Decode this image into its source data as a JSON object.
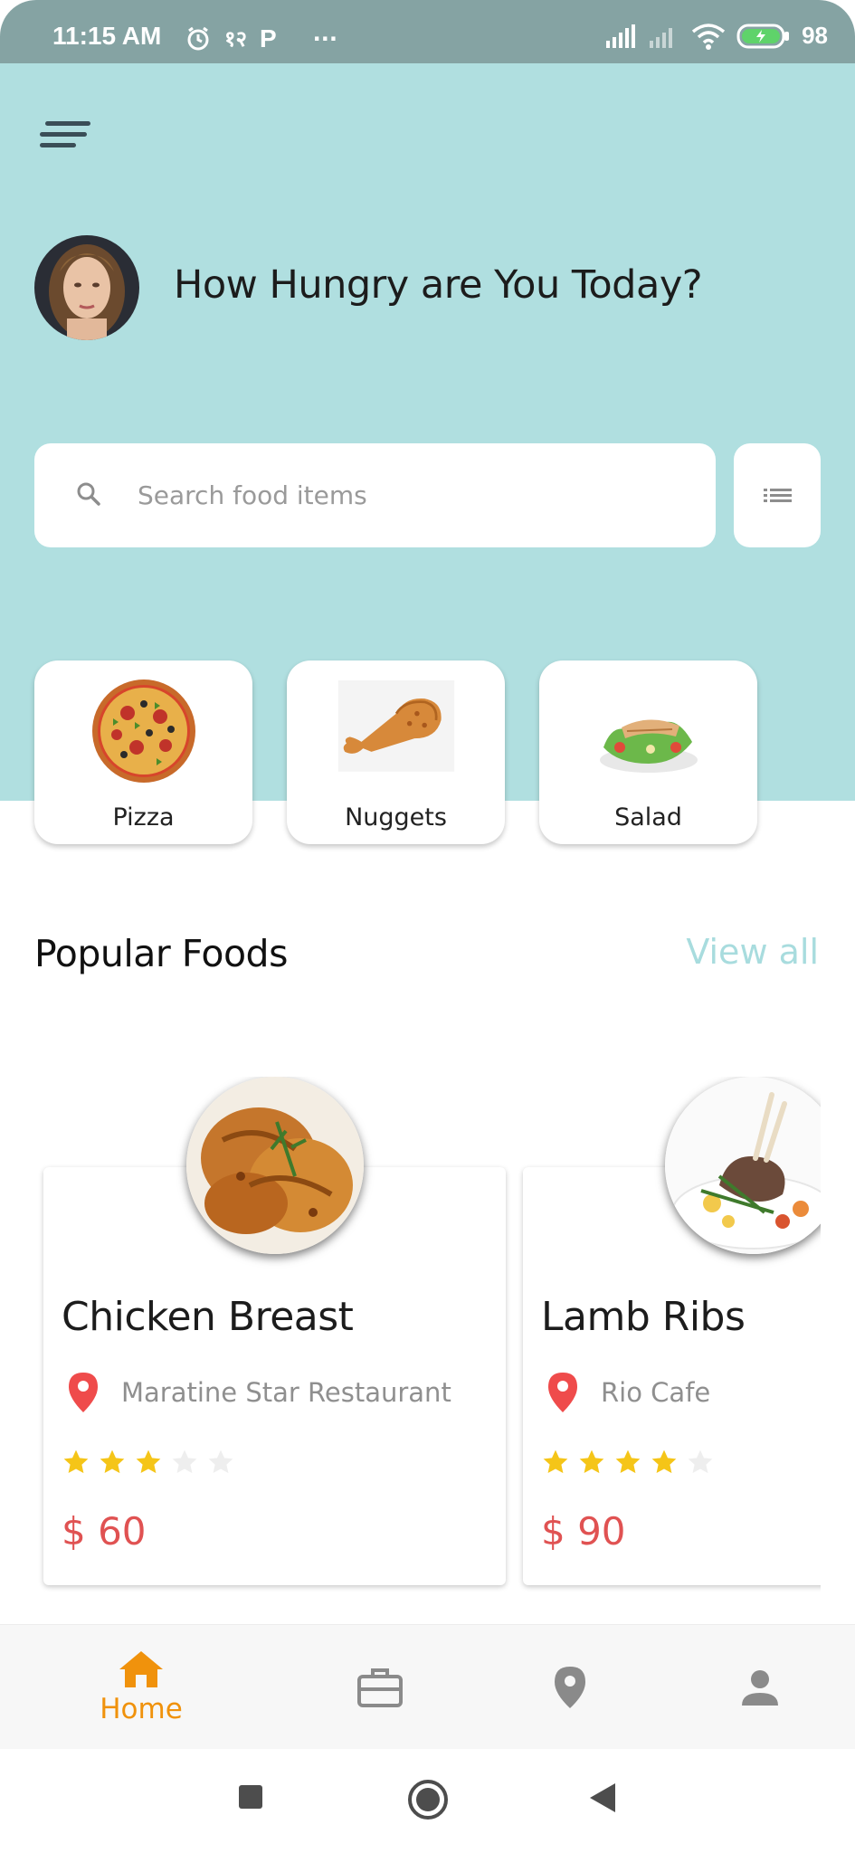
{
  "status_bar": {
    "time": "11:15 AM",
    "carrier_text": "१२",
    "notif_p": "P",
    "more": "···",
    "battery": "98"
  },
  "header": {
    "greeting": "How Hungry are You Today?",
    "menu_icon": "menu-icon",
    "avatar_icon": "avatar"
  },
  "search": {
    "placeholder": "Search food items",
    "value": ""
  },
  "categories": [
    {
      "label": "Pizza",
      "icon": "pizza-icon"
    },
    {
      "label": "Nuggets",
      "icon": "nuggets-icon"
    },
    {
      "label": "Salad",
      "icon": "salad-icon"
    }
  ],
  "popular": {
    "title": "Popular Foods",
    "view_all": "View all",
    "items": [
      {
        "name": "Chicken Breast",
        "location": "Maratine Star Restaurant",
        "rating": 3,
        "max_rating": 5,
        "price": "$ 60"
      },
      {
        "name": "Lamb Ribs",
        "location": "Rio Cafe",
        "rating": 4,
        "max_rating": 5,
        "price": "$ 90"
      }
    ]
  },
  "bottom_nav": {
    "items": [
      {
        "label": "Home",
        "icon": "home-icon",
        "active": true
      },
      {
        "label": "",
        "icon": "briefcase-icon",
        "active": false
      },
      {
        "label": "",
        "icon": "location-icon",
        "active": false
      },
      {
        "label": "",
        "icon": "person-icon",
        "active": false
      }
    ]
  },
  "colors": {
    "hero_bg": "#b0dfe0",
    "accent_orange": "#f0920c",
    "price_red": "#e05252",
    "star_yellow": "#f5c518",
    "pin_red": "#ef4b4b"
  }
}
